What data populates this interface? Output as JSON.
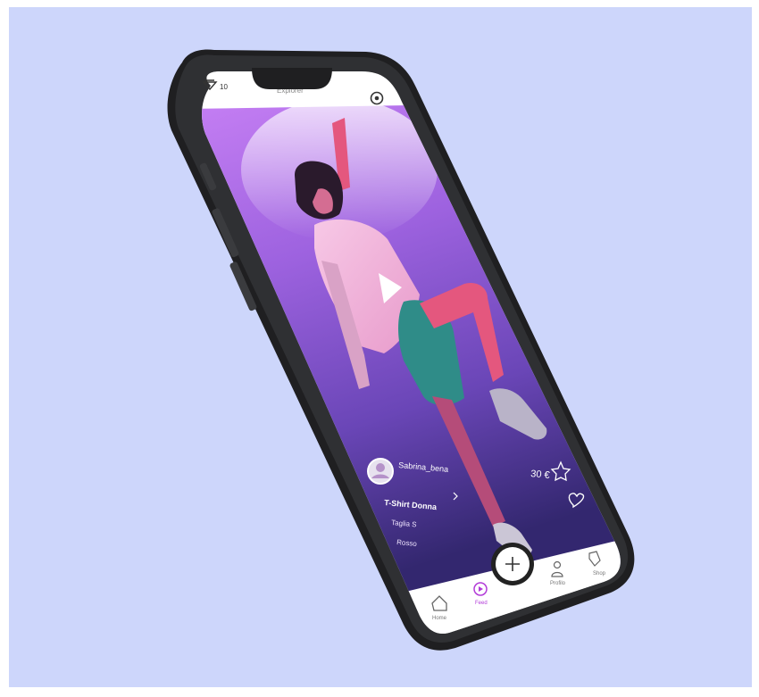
{
  "top_bar": {
    "gems_count": "10",
    "title": "Explorer"
  },
  "post": {
    "username": "Sabrina_bena",
    "product_name": "T-Shirt Donna",
    "size_label": "Taglia S",
    "color_label": "Rosso",
    "price": "30 €"
  },
  "tab_bar": {
    "home": "Home",
    "feed": "Feed",
    "profile": "Profilo",
    "shop": "Shop"
  },
  "colors": {
    "background": "#cdd6fb",
    "screen_gradient_top": "#b36ff0",
    "screen_gradient_bottom": "#3b2a7e",
    "accent": "#b23bd8",
    "phone_frame": "#2a2a2c"
  },
  "icons": [
    "gem-icon",
    "settings-icon",
    "play-icon",
    "star-icon",
    "heart-icon",
    "chevron-right-icon",
    "plus-icon",
    "home-icon",
    "feed-play-icon",
    "profile-icon",
    "shop-tag-icon"
  ]
}
